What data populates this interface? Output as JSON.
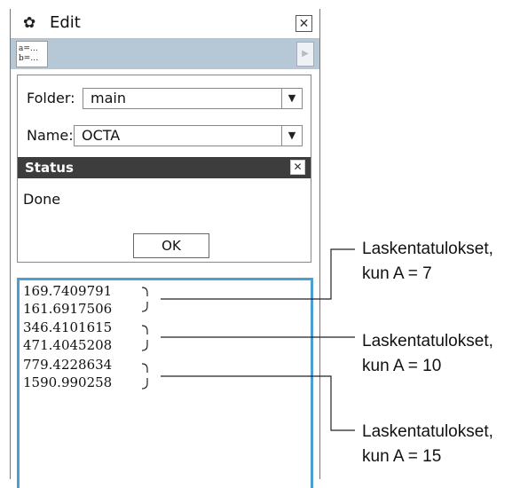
{
  "window": {
    "title": "Edit"
  },
  "toolbar": {
    "var_icon_line1": "a=…",
    "var_icon_line2": "b=…"
  },
  "dialog": {
    "folder_label": "Folder:",
    "folder_value": "main",
    "name_label": "Name:",
    "name_value": "OCTA",
    "status_title": "Status",
    "status_text": "Done",
    "ok_label": "OK"
  },
  "results": [
    "169.7409791",
    "161.6917506",
    "346.4101615",
    "471.4045208",
    "779.4228634",
    "1590.990258"
  ],
  "annotations": [
    {
      "line1": "Laskentatulokset,",
      "line2": "kun A = 7"
    },
    {
      "line1": "Laskentatulokset,",
      "line2": "kun A = 10"
    },
    {
      "line1": "Laskentatulokset,",
      "line2": "kun A = 15"
    }
  ]
}
